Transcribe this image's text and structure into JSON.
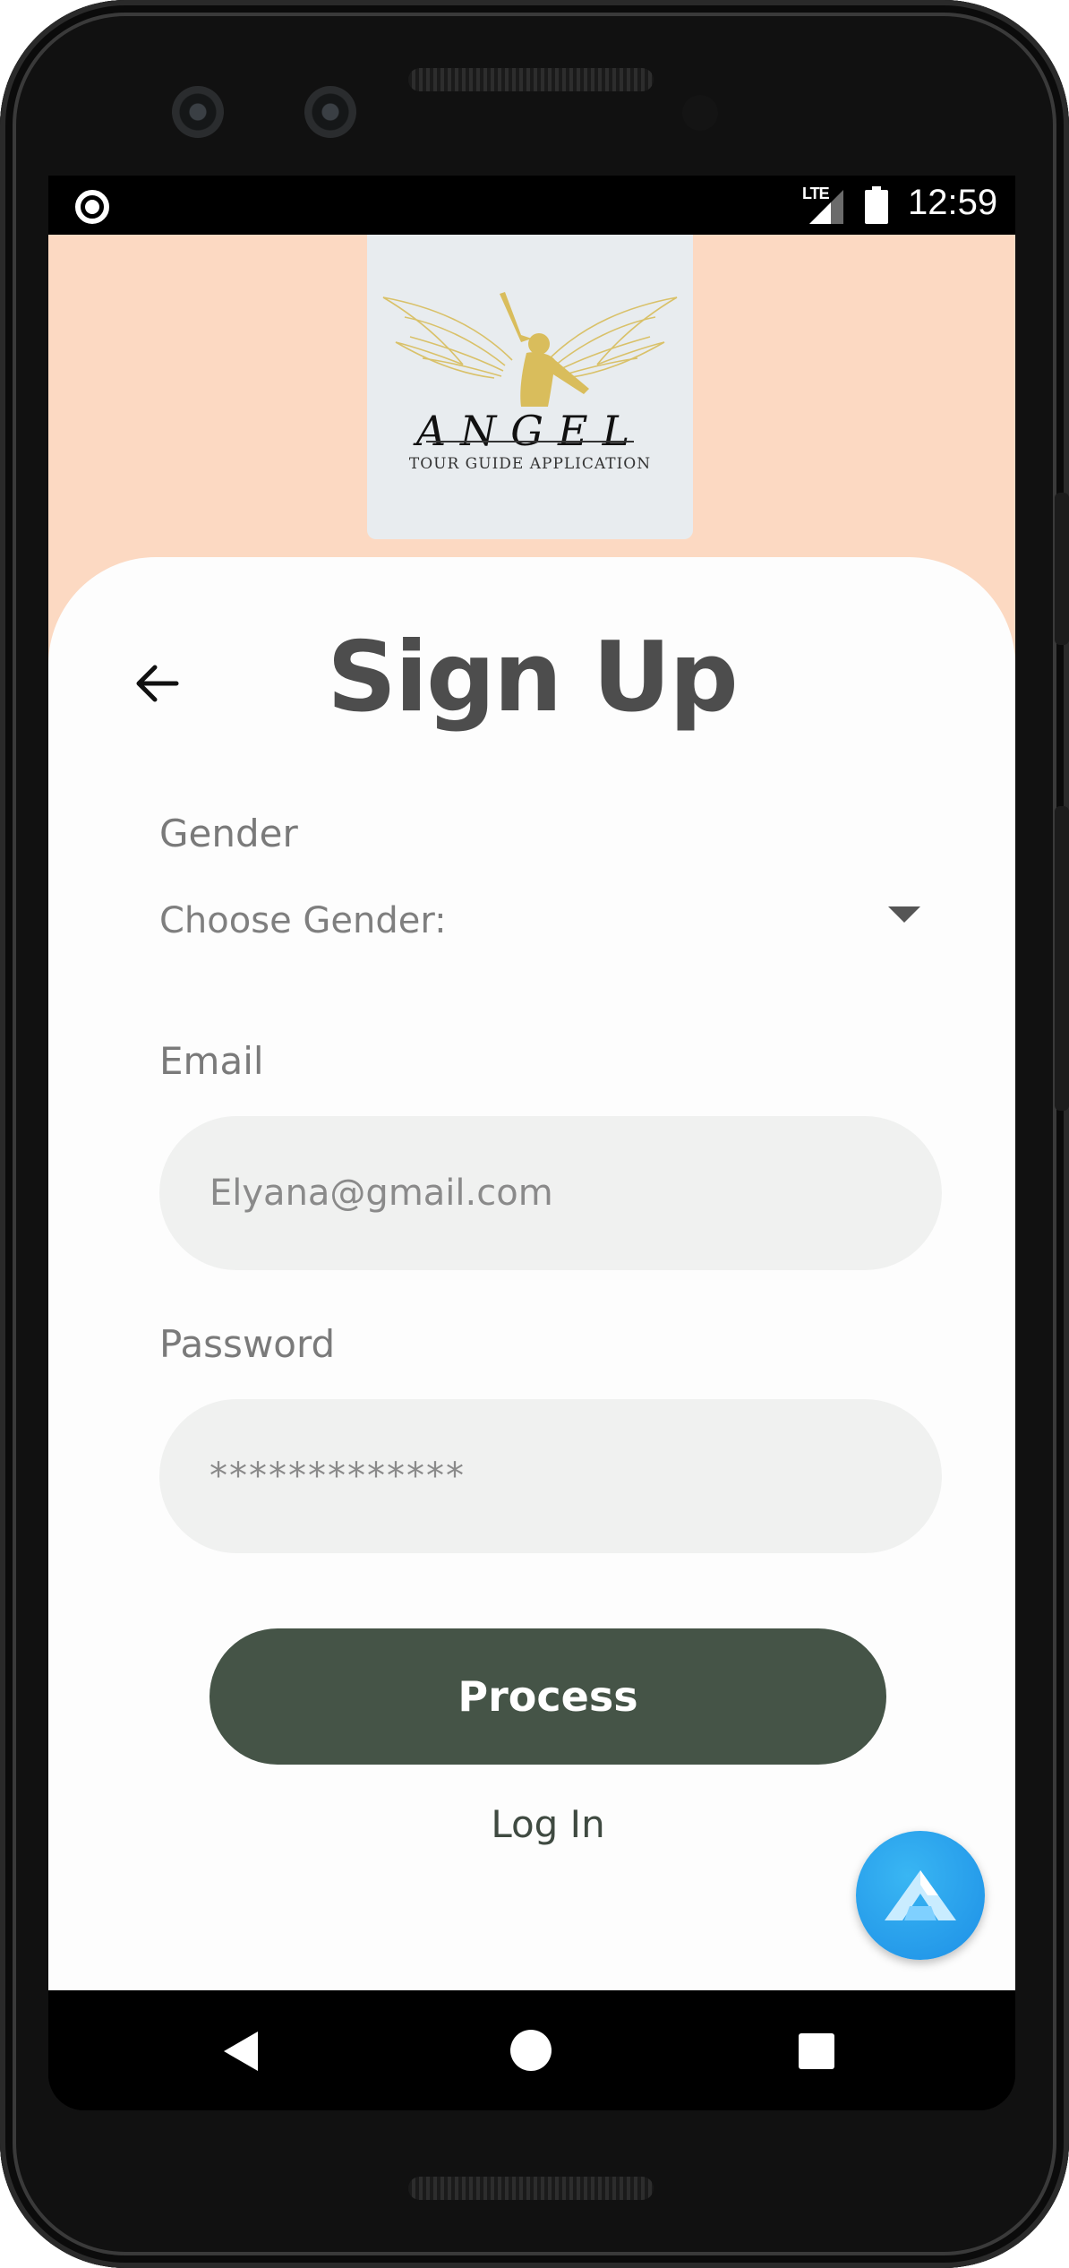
{
  "status_bar": {
    "network": "LTE",
    "time": "12:59"
  },
  "logo": {
    "title": "ANGEL",
    "subtitle": "TOUR GUIDE APPLICATION"
  },
  "form": {
    "title": "Sign Up",
    "gender": {
      "label": "Gender",
      "selected": "Choose Gender:"
    },
    "email": {
      "label": "Email",
      "placeholder": "Elyana@gmail.com"
    },
    "password": {
      "label": "Password",
      "placeholder": "*************"
    },
    "submit_label": "Process",
    "login_link": "Log In"
  },
  "colors": {
    "header_background": "#fcd9c2",
    "button_background": "#455447",
    "title_text": "#4d4d4d",
    "fab_blue": "#1d8fe6"
  },
  "icons": [
    "back-arrow-icon",
    "dropdown-arrow-icon",
    "lte-signal-icon",
    "battery-icon",
    "app-fab-icon",
    "nav-back-icon",
    "nav-home-icon",
    "nav-recents-icon"
  ]
}
